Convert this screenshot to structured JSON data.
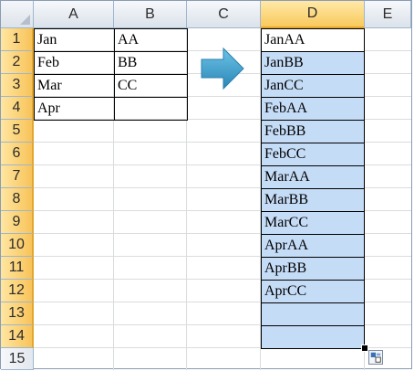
{
  "columns": [
    "A",
    "B",
    "C",
    "D",
    "E"
  ],
  "selected_column": "D",
  "rows": [
    "1",
    "2",
    "3",
    "4",
    "5",
    "6",
    "7",
    "8",
    "9",
    "10",
    "11",
    "12",
    "13",
    "14",
    "15"
  ],
  "column_a": [
    "Jan",
    "Feb",
    "Mar",
    "Apr"
  ],
  "column_b": [
    "AA",
    "BB",
    "CC",
    ""
  ],
  "column_d": [
    "JanAA",
    "JanBB",
    "JanCC",
    "FebAA",
    "FebBB",
    "FebCC",
    "MarAA",
    "MarBB",
    "MarCC",
    "AprAA",
    "AprBB",
    "AprCC",
    "",
    ""
  ],
  "colors": {
    "selection_fill": "#c5dcf7",
    "header_highlight": "#f9c95d",
    "arrow": "#3d9fc8"
  },
  "icons": [
    "arrow-right-icon",
    "paste-options-icon",
    "select-all-triangle-icon"
  ]
}
